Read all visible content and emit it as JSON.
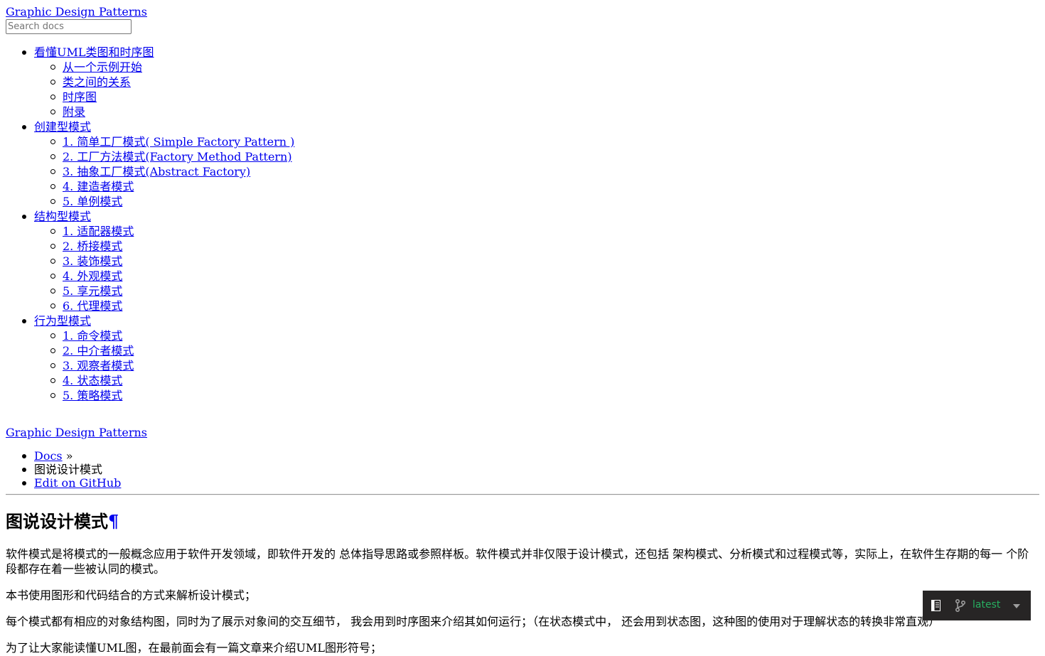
{
  "header": {
    "brand": "Graphic Design Patterns",
    "search_placeholder": "Search docs"
  },
  "nav": {
    "sections": [
      {
        "title": "看懂UML类图和时序图",
        "items": [
          "从一个示例开始",
          "类之间的关系",
          "时序图",
          "附录"
        ]
      },
      {
        "title": "创建型模式",
        "items": [
          "1. 简单工厂模式( Simple Factory Pattern )",
          "2. 工厂方法模式(Factory Method Pattern)",
          "3. 抽象工厂模式(Abstract Factory)",
          "4. 建造者模式",
          "5. 单例模式"
        ]
      },
      {
        "title": "结构型模式",
        "items": [
          "1. 适配器模式",
          "2. 桥接模式",
          "3. 装饰模式",
          "4. 外观模式",
          "5. 享元模式",
          "6. 代理模式"
        ]
      },
      {
        "title": "行为型模式",
        "items": [
          "1. 命令模式",
          "2. 中介者模式",
          "3. 观察者模式",
          "4. 状态模式",
          "5. 策略模式"
        ]
      }
    ]
  },
  "topbar": {
    "brand": "Graphic Design Patterns"
  },
  "breadcrumbs": {
    "docs": "Docs",
    "separator": " »",
    "current": "图说设计模式",
    "edit": "Edit on GitHub"
  },
  "content": {
    "title": "图说设计模式",
    "headerlink": "¶",
    "paragraphs": [
      "软件模式是将模式的一般概念应用于软件开发领域，即软件开发的 总体指导思路或参照样板。软件模式并非仅限于设计模式，还包括 架构模式、分析模式和过程模式等，实际上，在软件生存期的每一 个阶段都存在着一些被认同的模式。",
      "本书使用图形和代码结合的方式来解析设计模式；",
      "每个模式都有相应的对象结构图，同时为了展示对象间的交互细节， 我会用到时序图来介绍其如何运行；（在状态模式中， 还会用到状态图，这种图的使用对于理解状态的转换非常直观）",
      "为了让大家能读懂UML图，在最前面会有一篇文章来介绍UML图形符号；"
    ]
  },
  "versions": {
    "label": "latest",
    "book_icon": "book-icon",
    "branch_icon": "git-branch-icon",
    "caret_icon": "caret-down-icon",
    "accent": "#27ae60",
    "background": "#272525"
  }
}
